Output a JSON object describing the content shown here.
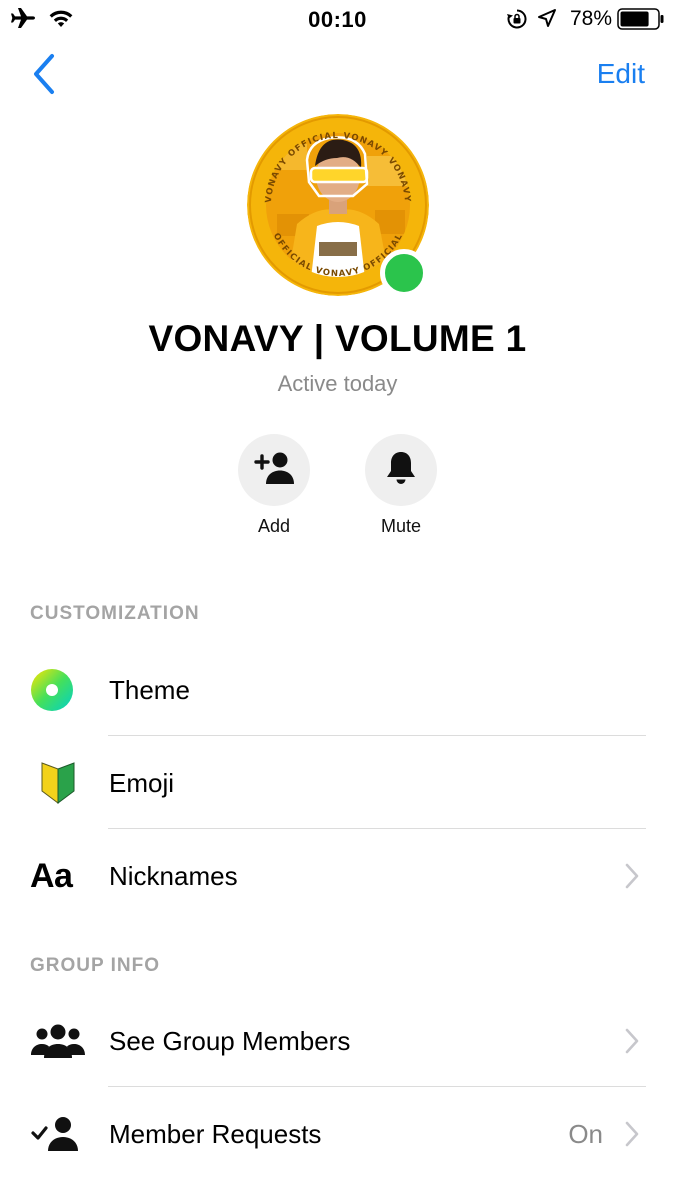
{
  "status_bar": {
    "time": "00:10",
    "battery_percent": "78%",
    "battery_level": 0.78,
    "icons": [
      "airplane-icon",
      "wifi-icon",
      "orientation-lock-icon",
      "location-icon",
      "battery-icon"
    ]
  },
  "nav": {
    "back_icon": "chevron-left-icon",
    "edit_label": "Edit"
  },
  "profile": {
    "name": "VONAVY | VOLUME 1",
    "status": "Active today",
    "avatar_ring_text": "VONAVY OFFICIAL",
    "online": true
  },
  "actions": [
    {
      "label": "Add",
      "icon": "add-person-icon"
    },
    {
      "label": "Mute",
      "icon": "bell-icon"
    }
  ],
  "customization": {
    "header": "CUSTOMIZATION",
    "items": [
      {
        "label": "Theme",
        "icon": "theme-gradient-icon"
      },
      {
        "label": "Emoji",
        "icon": "beginner-shield-emoji-icon"
      },
      {
        "label": "Nicknames",
        "icon": "text-aa-icon",
        "icon_text": "Aa"
      }
    ]
  },
  "group_info": {
    "header": "GROUP INFO",
    "items": [
      {
        "label": "See Group Members",
        "icon": "group-members-icon"
      },
      {
        "label": "Member Requests",
        "icon": "member-requests-icon",
        "value": "On"
      }
    ]
  },
  "colors": {
    "accent_blue": "#1a7ff0",
    "online_green": "#2bc44c",
    "section_gray": "#a4a4a4",
    "action_bg": "#efefef"
  }
}
